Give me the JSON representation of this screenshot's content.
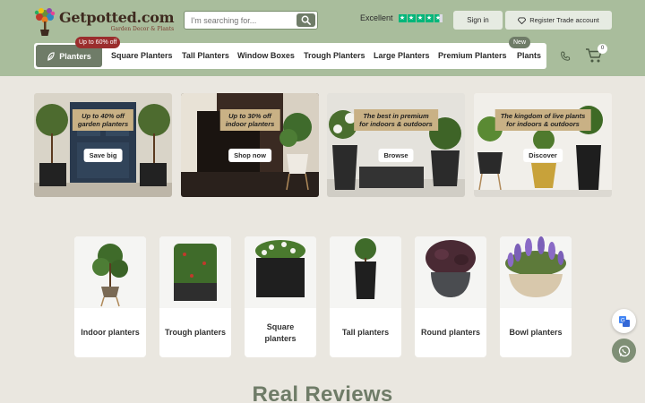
{
  "header": {
    "logo_name": "Getpotted.com",
    "logo_tagline": "Garden Decor & Plants",
    "search_placeholder": "I'm searching for...",
    "trust_label": "Excellent",
    "signin_label": "Sign in",
    "trade_label": "Register Trade account",
    "cart_count": "0"
  },
  "nav": {
    "planters_label": "Planters",
    "sale_badge": "Up to 60% off",
    "new_badge": "New",
    "items": [
      "Square Planters",
      "Tall Planters",
      "Window Boxes",
      "Trough Planters",
      "Large Planters",
      "Premium Planters",
      "Plants"
    ]
  },
  "banners": [
    {
      "tag_line1": "Up to 40% off",
      "tag_line2": "garden planters",
      "button": "Save big"
    },
    {
      "tag_line1": "Up to 30% off",
      "tag_line2": "indoor planters",
      "button": "Shop now"
    },
    {
      "tag_line1": "The best in premium",
      "tag_line2": "for indoors & outdoors",
      "button": "Browse"
    },
    {
      "tag_line1": "The kingdom of live plants",
      "tag_line2": "for indoors & outdoors",
      "button": "Discover"
    }
  ],
  "categories": [
    {
      "label": "Indoor planters"
    },
    {
      "label": "Trough planters"
    },
    {
      "label": "Square planters"
    },
    {
      "label": "Tall planters"
    },
    {
      "label": "Round planters"
    },
    {
      "label": "Bowl planters"
    }
  ],
  "reviews_title": "Real Reviews",
  "colors": {
    "header_bg": "#a9bd9c",
    "accent": "#6f7c68",
    "sale_badge": "#9b2d2d",
    "trustpilot": "#00b67a",
    "page_bg": "#eae7e0"
  },
  "icons": [
    "search-icon",
    "leaf-icon",
    "diamond-icon",
    "phone-icon",
    "cart-icon",
    "translate-icon",
    "whatsapp-icon"
  ]
}
